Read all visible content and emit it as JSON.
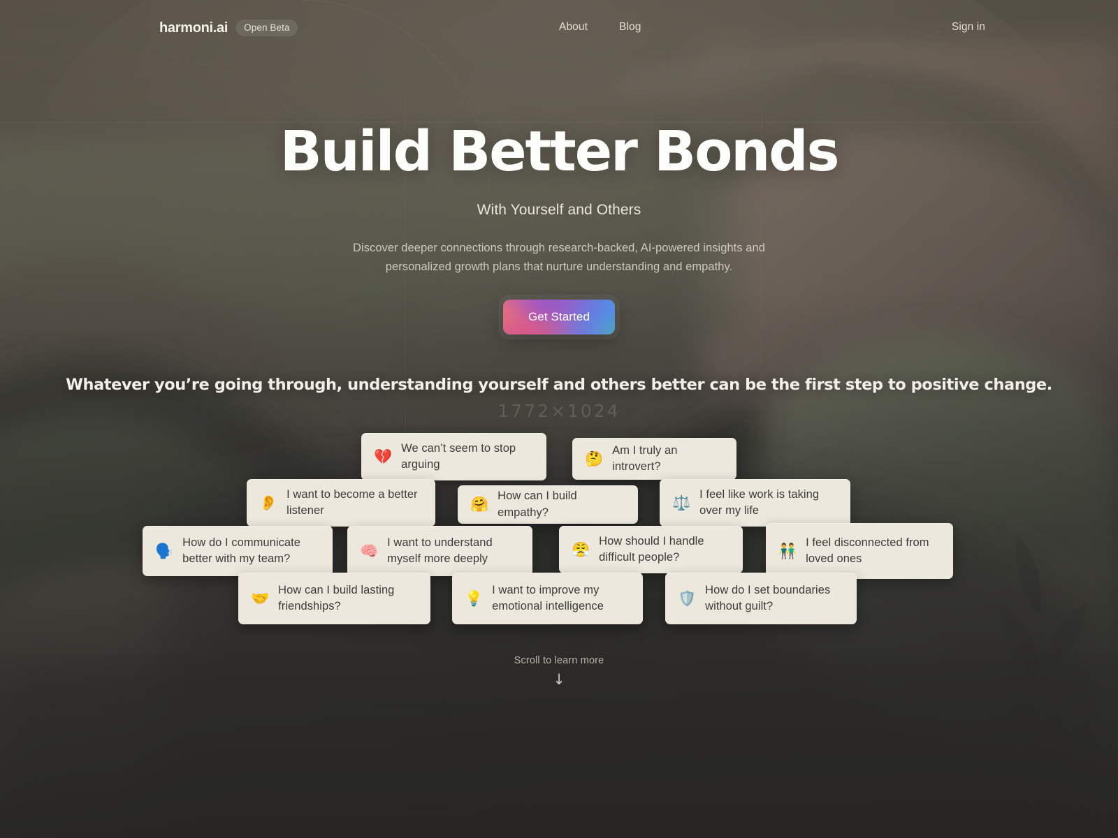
{
  "header": {
    "logo": "harmoni.ai",
    "badge": "Open Beta",
    "nav": [
      {
        "label": "About"
      },
      {
        "label": "Blog"
      }
    ],
    "signin": "Sign in"
  },
  "hero": {
    "title": "Build Better Bonds",
    "subtitle": "With Yourself and Others",
    "description": "Discover deeper connections through research-backed, AI-powered insights and personalized growth plans that nurture understanding and empathy.",
    "cta_label": "Get Started"
  },
  "tagline": "Whatever you’re going through, understanding yourself and others better can be the first step to positive change.",
  "watermark": "1772×1024",
  "cards": [
    {
      "emoji": "💔",
      "emoji_name": "broken-heart-icon",
      "text": "We can’t seem to stop arguing"
    },
    {
      "emoji": "🤔",
      "emoji_name": "thinking-face-icon",
      "text": "Am I truly an introvert?"
    },
    {
      "emoji": "👂",
      "emoji_name": "ear-icon",
      "text": "I want to become a better listener"
    },
    {
      "emoji": "🤗",
      "emoji_name": "hugging-face-icon",
      "text": "How can I build empathy?"
    },
    {
      "emoji": "⚖️",
      "emoji_name": "balance-scale-icon",
      "text": "I feel like work is taking over my life"
    },
    {
      "emoji": "🗣️",
      "emoji_name": "speaking-head-icon",
      "text": "How do I communicate better with my team?"
    },
    {
      "emoji": "🧠",
      "emoji_name": "brain-icon",
      "text": "I want to understand myself more deeply"
    },
    {
      "emoji": "😤",
      "emoji_name": "face-with-steam-icon",
      "text": "How should I handle difficult people?"
    },
    {
      "emoji": "👬",
      "emoji_name": "two-people-icon",
      "text": "I feel disconnected from loved ones"
    },
    {
      "emoji": "🤝",
      "emoji_name": "handshake-icon",
      "text": "How can I build lasting friendships?"
    },
    {
      "emoji": "💡",
      "emoji_name": "light-bulb-icon",
      "text": "I want to improve my emotional intelligence"
    },
    {
      "emoji": "🛡️",
      "emoji_name": "shield-icon",
      "text": "How do I set boundaries without guilt?"
    }
  ],
  "scroll": {
    "label": "Scroll to learn more",
    "arrow": "↓"
  },
  "colors": {
    "background": "#4a453c",
    "card_bg": "#ece8de",
    "card_text": "#3d3b38",
    "heading": "#fdfdfb",
    "cta_gradient_start": "#ef6f6c",
    "cta_gradient_mid": "#9a56c8",
    "cta_gradient_end": "#52b6c6"
  }
}
